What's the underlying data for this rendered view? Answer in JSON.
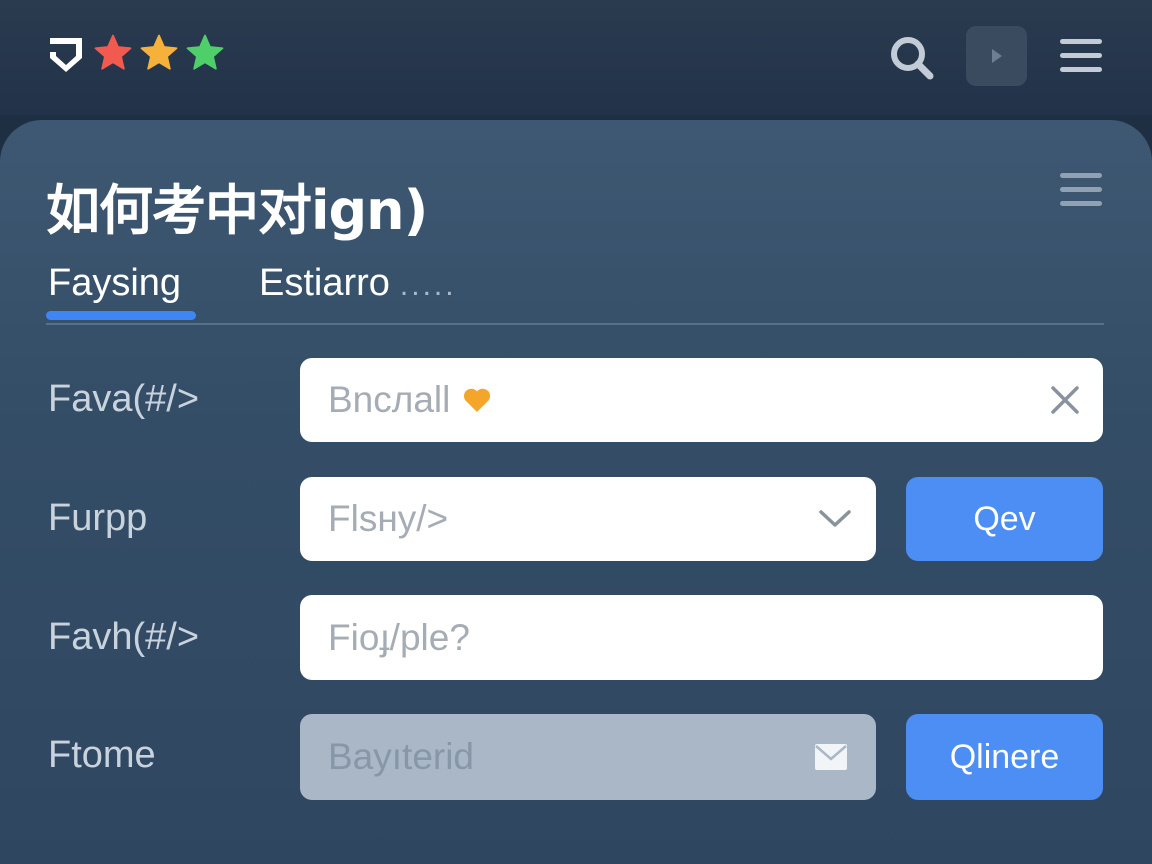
{
  "header": {
    "icons": [
      "brand-logo-icon",
      "star-red-icon",
      "star-yellow-icon",
      "star-green-icon",
      "search-icon",
      "play-icon",
      "menu-icon"
    ],
    "star_colors": [
      "#f25a4f",
      "#f6b13a",
      "#4fcf6a"
    ]
  },
  "card": {
    "title": "如何考中对ign)",
    "tabs": [
      {
        "label": "Faysing",
        "active": true
      },
      {
        "label": "Estiarro",
        "suffix": "....."
      }
    ],
    "accent": "#3f86f4"
  },
  "form": {
    "rows": [
      {
        "label": "Fava(#/>",
        "value": "Bncлall",
        "icon": "heart-icon",
        "trailing_icon": "clear-x-icon"
      },
      {
        "label": "Furpp",
        "value": "Flsнy/>",
        "trailing_icon": "chevron-down-icon",
        "button": "Qev"
      },
      {
        "label": "Favh(#/>",
        "value": "Fioɟ/ple?"
      },
      {
        "label": "Ftome",
        "value": "Bayıterid",
        "trailing_icon": "mail-icon",
        "button": "Qlinere",
        "disabled": true
      }
    ]
  }
}
